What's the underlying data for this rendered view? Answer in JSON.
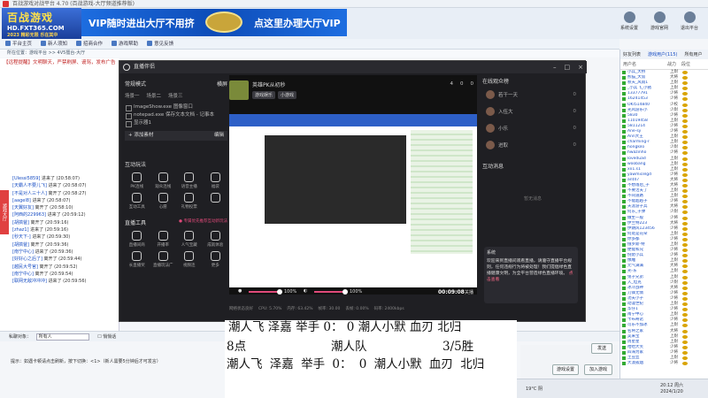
{
  "window": {
    "title": "百战游戏对战平台 4.70 (百战游戏-大厅频道推荐版)"
  },
  "banner": {
    "logo_main": "百战游戏",
    "logo_url": "HD.FXT365.COM",
    "logo_sub": "2023 精彩无限 乐在其中",
    "vip_left": "VIP随时进出大厅不用挤",
    "vip_right": "点这里办理大厅VIP"
  },
  "top_buttons": [
    "系统设置",
    "游戏官网",
    "退出平台"
  ],
  "toolbar": [
    "平台主页",
    "新人须知",
    "招商合作",
    "游戏帮助",
    "意见反馈"
  ],
  "breadcrumb": "所在位置：游戏平台 >> 4V5擂台-大厅",
  "notice": "【远程提醒】文明聊天，严禁刷屏、谩骂，发布广告",
  "side_tab": "游戏大厅",
  "chat_log": [
    {
      "user": "[Ulessi5859]",
      "msg": "进来了 (20:58:07)"
    },
    {
      "user": "[天霸人不要儿飞]",
      "msg": "进来了 (20:58:07)"
    },
    {
      "user": "[不是对人三十人]",
      "msg": "离开了 (20:58:27)"
    },
    {
      "user": "[aagel8]",
      "msg": "进来了 (20:58:07)"
    },
    {
      "user": "[天翼好友]",
      "msg": "离开了 (20:58:10)"
    },
    {
      "user": "[阿西的229963]",
      "msg": "进来了 (20:59:12)"
    },
    {
      "user": "[胡搞爸]",
      "msg": "离开了 (20:59:16)"
    },
    {
      "user": "[zhaz1]",
      "msg": "进来了 (20:59:16)"
    },
    {
      "user": "[秒天下-]",
      "msg": "进来了 (20:59:30)"
    },
    {
      "user": "[胡搞爸]",
      "msg": "离开了 (20:59:36)"
    },
    {
      "user": "[南宁中心]",
      "msg": "进来了 (20:59:36)"
    },
    {
      "user": "[好好心之后了]",
      "msg": "离开了 (20:59:44)"
    },
    {
      "user": "[越民大号官]",
      "msg": "离开了 (20:59:52)"
    },
    {
      "user": "[南宁中心]",
      "msg": "离开了 (20:59:54)"
    },
    {
      "user": "[联网无敌冲冲冲]",
      "msg": "进来了 (20:59:56)"
    }
  ],
  "obs": {
    "title": "直播伴侣",
    "mode_label": "常规模式",
    "mode_toggle": "横屏",
    "scene_tabs": [
      "场景一",
      "场景二",
      "场景三"
    ],
    "sources": [
      "ImageShow.exe 图像窗口",
      "notepad.exe 保存文本文档 - 记事本",
      "显示器1"
    ],
    "add_material": "+ 添加素材",
    "add_material_right": "编辑",
    "interact_label": "互动玩法",
    "interact_items": [
      "PK连线",
      "观众连线",
      "语音主播",
      "福袋",
      "互动工具",
      "心愿",
      "礼物投票",
      ""
    ],
    "tools_label": "直播工具",
    "tools_hint": "● 专属优先推荐互动新玩法",
    "tools_items": [
      "直播间商",
      "开播率",
      "人气宝藏",
      "成就体验",
      "长直播奖",
      "直播玩法广",
      "视频连",
      "更多"
    ],
    "room_name": "英雄PK从初秒",
    "room_tags": [
      "游戏娱乐",
      "小游戏"
    ],
    "room_stats": [
      "4",
      "0",
      "0"
    ],
    "vol_label_1": "100%",
    "vol_label_2": "100%",
    "timer": "00:09:08",
    "timer_label": "关播",
    "status": [
      "网络状态良好",
      "CPU: 5.70%",
      "内存: 63.42%",
      "帧率: 30.00",
      "丢帧: 0.00%",
      "码率: 2400kbps"
    ],
    "viewers_label": "在线观众榜",
    "viewers": [
      {
        "name": "若干一天",
        "count": "0"
      },
      {
        "name": "入伍大",
        "count": "0"
      },
      {
        "name": "小乐",
        "count": "0"
      },
      {
        "name": "进取",
        "count": "0"
      }
    ],
    "msg_label": "互动消息",
    "msg_empty": "暂无消息",
    "msg_box_user": "系统",
    "msg_box_text": "欢迎来到直播间观看直播，请遵守直播平台规则，任何违规行为将被处理！我们提倡绿色直播健康文明，为全平台营造绿色直播环境。",
    "msg_box_link": "点击查看"
  },
  "overlay": {
    "row1": "潮人飞 泽嘉 举手 0： 0 潮人小默 血刃 北归",
    "row2_a": "8点",
    "row2_b": "潮人队",
    "row2_c": "3/5胜",
    "row3": "潮人飞 泽嘉 举手 0： 0 潮人小默 血刃 北归"
  },
  "input_row": {
    "label": "私聊对象：",
    "target": "所有人",
    "check": "悄悄话"
  },
  "tip": "提示：如遇卡顿请点击刷新，按下切换：<1>（新人需要5分钟后才可发言）",
  "bottom_buttons": {
    "send": "发送",
    "setup": "游戏设置",
    "start": "加入游戏"
  },
  "userlist": {
    "tabs": [
      "好友列表",
      "游戏用户(115)",
      "所有用户"
    ],
    "head": [
      "用户名",
      "战力",
      "段位"
    ],
    "rows": [
      {
        "name": "小兵_大桥",
        "grade": "上尉"
      },
      {
        "name": "熊猫_大叔",
        "grade": "大将"
      },
      {
        "name": "秋天_风雨1",
        "grade": "上尉"
      },
      {
        "name": "_小兵飞_小猪",
        "grade": "上尉"
      },
      {
        "name": "13377791",
        "grade": "少将"
      },
      {
        "name": "16241453",
        "grade": "少将"
      },
      {
        "name": "OKI514840",
        "grade": "少校"
      },
      {
        "name": "光风游乐小",
        "grade": "少尉"
      },
      {
        "name": "5830",
        "grade": "少将"
      },
      {
        "name": "11019458",
        "grade": "上尉"
      },
      {
        "name": "5811214",
        "grade": "少将"
      },
      {
        "name": "Ane-sy",
        "grade": "少将"
      },
      {
        "name": "Ann大王",
        "grade": "上尉"
      },
      {
        "name": "charming-r",
        "grade": "上尉"
      },
      {
        "name": "hongkilo",
        "grade": "少尉"
      },
      {
        "name": "hwazinho",
        "grade": "少将"
      },
      {
        "name": "loveduad",
        "grade": "上尉"
      },
      {
        "name": "woobang",
        "grade": "上尉"
      },
      {
        "name": "xx1.s1",
        "grade": "上尉"
      },
      {
        "name": "yawmicelgd",
        "grade": "少将"
      },
      {
        "name": "ant47",
        "grade": "大将"
      },
      {
        "name": "不想落后_子",
        "grade": "大将"
      },
      {
        "name": "不要活夫了",
        "grade": "上尉"
      },
      {
        "name": "不同道路",
        "grade": "上尉"
      },
      {
        "name": "不能超越子",
        "grade": "少将"
      },
      {
        "name": "天涯游子兵",
        "grade": "大将"
      },
      {
        "name": "何东_子弹",
        "grade": "少尉"
      },
      {
        "name": "做生一般",
        "grade": "少将"
      },
      {
        "name": "伊兰特223",
        "grade": "大将"
      },
      {
        "name": "伊朗风123456",
        "grade": "少将"
      },
      {
        "name": "何处是花朵",
        "grade": "上尉"
      },
      {
        "name": "你多都",
        "grade": "少将"
      },
      {
        "name": "俄罗斯-特",
        "grade": "上尉"
      },
      {
        "name": "便能和兄",
        "grade": "少将"
      },
      {
        "name": "倪佬小兵",
        "grade": "少将"
      },
      {
        "name": "像雕",
        "grade": "上尉"
      },
      {
        "name": "元气满满",
        "grade": "大将"
      },
      {
        "name": "光-东",
        "grade": "上尉"
      },
      {
        "name": "兔子兄弟",
        "grade": "上尉"
      },
      {
        "name": "入_坦克",
        "grade": "少尉"
      },
      {
        "name": "冰冷战神",
        "grade": "大将"
      },
      {
        "name": "刀锋无情",
        "grade": "少将"
      },
      {
        "name": "功夫小子",
        "grade": "少将"
      },
      {
        "name": "动漫世纪",
        "grade": "上尉"
      },
      {
        "name": "华仔1",
        "grade": "少将"
      },
      {
        "name": "南宁中心",
        "grade": "上尉"
      },
      {
        "name": "卡布奇诺",
        "grade": "少将"
      },
      {
        "name": "可乐不加冰",
        "grade": "上尉"
      },
      {
        "name": "名将之家",
        "grade": "大将"
      },
      {
        "name": "吴来宝",
        "grade": "上尉"
      },
      {
        "name": "周星星",
        "grade": "上尉"
      },
      {
        "name": "哈哈大笑",
        "grade": "少将"
      },
      {
        "name": "四海为家",
        "grade": "少将"
      },
      {
        "name": "土豆丝",
        "grade": "上尉"
      },
      {
        "name": "大漠孤烟",
        "grade": "少将"
      }
    ]
  },
  "taskbar": {
    "weather": "19°C 阴",
    "time": "20:12 周六",
    "date": "2024/1/20"
  },
  "colors": {
    "accent": "#1d6de0",
    "obs_bg": "#1f1f23",
    "live_pink": "#e04a7a"
  }
}
